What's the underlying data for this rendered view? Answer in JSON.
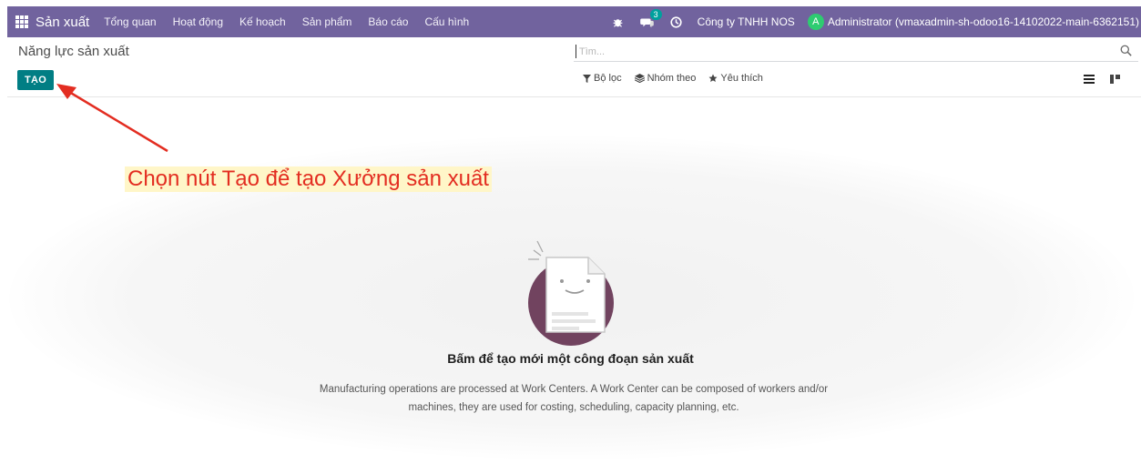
{
  "navbar": {
    "app_name": "Sản xuất",
    "menu": [
      {
        "label": "Tổng quan"
      },
      {
        "label": "Hoạt động"
      },
      {
        "label": "Kế hoạch"
      },
      {
        "label": "Sản phẩm"
      },
      {
        "label": "Báo cáo"
      },
      {
        "label": "Cấu hình"
      }
    ],
    "messages_badge": "3",
    "company": "Công ty TNHH NOS",
    "avatar_letter": "A",
    "user": "Administrator (vmaxadmin-sh-odoo16-14102022-main-6362151)",
    "color": "#71639e"
  },
  "control_panel": {
    "breadcrumb": "Năng lực sản xuất",
    "search_placeholder": "Tìm...",
    "create_label": "TẠO",
    "filter_label": "Bộ lọc",
    "group_label": "Nhóm theo",
    "favorite_label": "Yêu thích",
    "accent": "#017e84"
  },
  "empty_state": {
    "title": "Bấm để tạo mới một công đoạn sản xuất",
    "description": "Manufacturing operations are processed at Work Centers. A Work Center can be composed of workers and/or machines, they are used for costing, scheduling, capacity planning, etc."
  },
  "annotation": {
    "text": "Chọn nút Tạo để tạo Xưởng sản xuất",
    "color": "#e32d21"
  },
  "icons": [
    "apps-grid-icon",
    "bug-icon",
    "chat-icon",
    "clock-icon",
    "search-icon",
    "filter-icon",
    "layers-icon",
    "star-icon",
    "list-view-icon",
    "kanban-view-icon"
  ]
}
